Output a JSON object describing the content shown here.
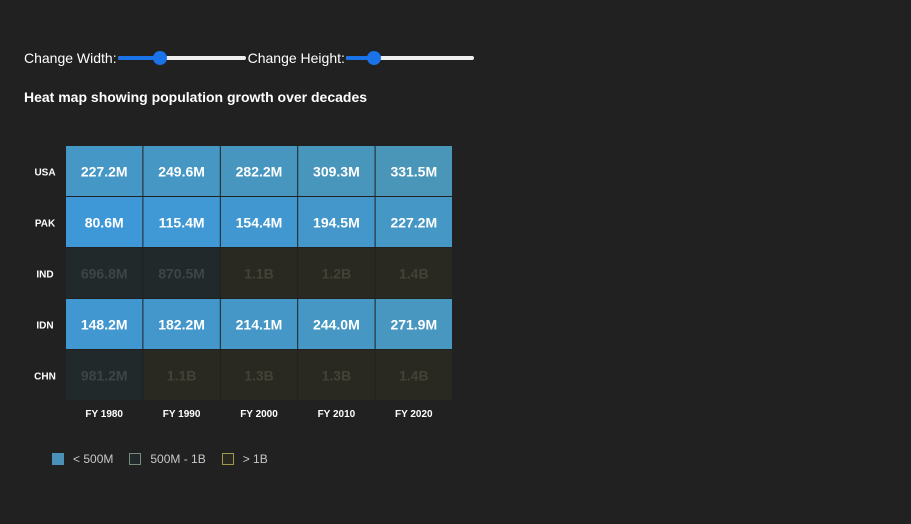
{
  "controls": {
    "width_label": "Change Width:",
    "height_label": "Change Height:",
    "width_level": 0.33,
    "height_level": 0.22
  },
  "title": "Heat map showing population growth over decades",
  "colors": {
    "under_500m": "#3e98cf",
    "mid_range": "#21292a",
    "over_1b": "#2a2921",
    "background": "#212121"
  },
  "chart_data": {
    "type": "heatmap",
    "title": "Heat map showing population growth over decades",
    "x": [
      "FY 1980",
      "FY 1990",
      "FY 2000",
      "FY 2010",
      "FY 2020"
    ],
    "y": [
      "USA",
      "PAK",
      "IND",
      "IDN",
      "CHN"
    ],
    "values": [
      [
        227.2,
        249.6,
        282.2,
        309.3,
        331.5
      ],
      [
        80.6,
        115.4,
        154.4,
        194.5,
        227.2
      ],
      [
        696.8,
        870.5,
        1100,
        1200,
        1400
      ],
      [
        148.2,
        182.2,
        214.1,
        244.0,
        271.9
      ],
      [
        981.2,
        1100,
        1300,
        1300,
        1400
      ]
    ],
    "labels": [
      [
        "227.2M",
        "249.6M",
        "282.2M",
        "309.3M",
        "331.5M"
      ],
      [
        "80.6M",
        "115.4M",
        "154.4M",
        "194.5M",
        "227.2M"
      ],
      [
        "696.8M",
        "870.5M",
        "1.1B",
        "1.2B",
        "1.4B"
      ],
      [
        "148.2M",
        "182.2M",
        "214.1M",
        "244.0M",
        "271.9M"
      ],
      [
        "981.2M",
        "1.1B",
        "1.3B",
        "1.3B",
        "1.4B"
      ]
    ],
    "unit": "millions",
    "legend": {
      "placement": "bottom-left",
      "items": [
        {
          "label": "< 500M",
          "color": "#4a90b8"
        },
        {
          "label": "500M - 1B",
          "color": "#21292a"
        },
        {
          "label": "> 1B",
          "color": "#2a2921"
        }
      ]
    }
  }
}
